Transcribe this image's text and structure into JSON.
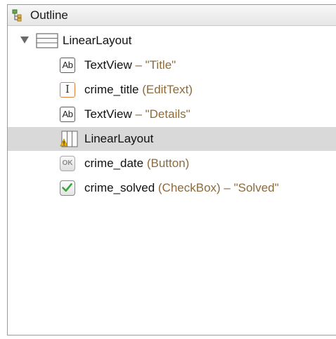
{
  "panel": {
    "title": "Outline"
  },
  "tree": {
    "root": {
      "label": "LinearLayout",
      "expanded": true
    },
    "items": [
      {
        "name": "TextView",
        "sep": " – ",
        "desc": "\"Title\""
      },
      {
        "name": "crime_title",
        "type": " (EditText)"
      },
      {
        "name": "TextView",
        "sep": " – ",
        "desc": "\"Details\""
      },
      {
        "name": "LinearLayout",
        "warning": true,
        "selected": true
      },
      {
        "name": "crime_date",
        "type": " (Button)"
      },
      {
        "name": "crime_solved",
        "type": " (CheckBox)",
        "sep": " – ",
        "desc": "\"Solved\""
      }
    ]
  },
  "colors": {
    "selection": "#d9d9d9",
    "type_text": "#8c6b3c",
    "edit_icon_border": "#d9834a",
    "check_green": "#3aa63a",
    "warning": "#f0b400"
  },
  "icons": {
    "panel": "outline-tree-icon",
    "layout": "linear-layout-icon",
    "textview": "textview-ab-icon",
    "edittext": "edittext-cursor-icon",
    "button": "button-ok-icon",
    "checkbox": "checkbox-checked-icon",
    "warning": "warning-icon"
  },
  "icon_text": {
    "ab": "Ab",
    "cursor": "I",
    "ok": "OK"
  }
}
